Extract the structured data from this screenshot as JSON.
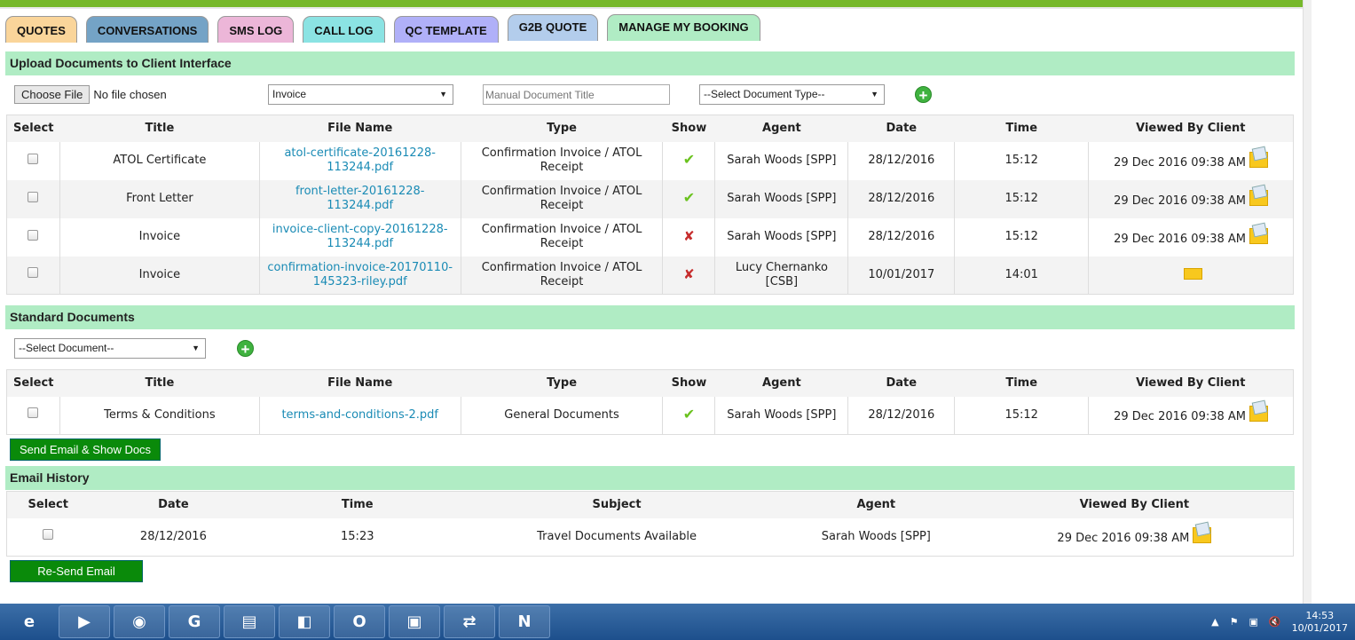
{
  "tabs": [
    {
      "label": "QUOTES",
      "color": "#fad59a"
    },
    {
      "label": "CONVERSATIONS",
      "color": "#74a3c6"
    },
    {
      "label": "SMS LOG",
      "color": "#ecb6d8"
    },
    {
      "label": "CALL LOG",
      "color": "#8be3e3"
    },
    {
      "label": "QC TEMPLATE",
      "color": "#b0b0f8"
    },
    {
      "label": "G2B QUOTE",
      "color": "#b3cdec"
    },
    {
      "label": "MANAGE MY BOOKING",
      "color": "#b0ecc4"
    }
  ],
  "upload": {
    "title": "Upload Documents to Client Interface",
    "choose_file": "Choose File",
    "no_file": "No file chosen",
    "doc_select": "Invoice",
    "title_placeholder": "Manual Document Title",
    "type_select": "--Select Document Type--",
    "headers": [
      "Select",
      "Title",
      "File Name",
      "Type",
      "Show",
      "Agent",
      "Date",
      "Time",
      "Viewed By Client"
    ],
    "rows": [
      {
        "title": "ATOL Certificate",
        "file": "atol-certificate-20161228-113244.pdf",
        "type": "Confirmation Invoice / ATOL Receipt",
        "show": true,
        "agent": "Sarah Woods [SPP]",
        "date": "28/12/2016",
        "time": "15:12",
        "viewed": "29 Dec 2016 09:38 AM"
      },
      {
        "title": "Front Letter",
        "file": "front-letter-20161228-113244.pdf",
        "type": "Confirmation Invoice / ATOL Receipt",
        "show": true,
        "agent": "Sarah Woods [SPP]",
        "date": "28/12/2016",
        "time": "15:12",
        "viewed": "29 Dec 2016 09:38 AM"
      },
      {
        "title": "Invoice",
        "file": "invoice-client-copy-20161228-113244.pdf",
        "type": "Confirmation Invoice / ATOL Receipt",
        "show": false,
        "agent": "Sarah Woods [SPP]",
        "date": "28/12/2016",
        "time": "15:12",
        "viewed": "29 Dec 2016 09:38 AM"
      },
      {
        "title": "Invoice",
        "file": "confirmation-invoice-20170110-145323-riley.pdf",
        "type": "Confirmation Invoice / ATOL Receipt",
        "show": false,
        "agent": "Lucy Chernanko [CSB]",
        "date": "10/01/2017",
        "time": "14:01",
        "viewed": ""
      }
    ]
  },
  "standard": {
    "title": "Standard Documents",
    "doc_select": "--Select Document--",
    "headers": [
      "Select",
      "Title",
      "File Name",
      "Type",
      "Show",
      "Agent",
      "Date",
      "Time",
      "Viewed By Client"
    ],
    "rows": [
      {
        "title": "Terms & Conditions",
        "file": "terms-and-conditions-2.pdf",
        "type": "General Documents",
        "show": true,
        "agent": "Sarah Woods [SPP]",
        "date": "28/12/2016",
        "time": "15:12",
        "viewed": "29 Dec 2016 09:38 AM"
      }
    ],
    "send_button": "Send Email & Show Docs"
  },
  "email_history": {
    "title": "Email History",
    "headers": [
      "Select",
      "Date",
      "Time",
      "Subject",
      "Agent",
      "Viewed By Client"
    ],
    "rows": [
      {
        "date": "28/12/2016",
        "time": "15:23",
        "subject": "Travel Documents Available",
        "agent": "Sarah Woods [SPP]",
        "viewed": "29 Dec 2016 09:38 AM"
      }
    ],
    "resend_button": "Re-Send Email"
  },
  "taskbar": {
    "apps": [
      "internet-explorer",
      "media-player",
      "chrome",
      "g-app",
      "file-explorer",
      "sticky-notes",
      "outlook",
      "remote-desktop",
      "app-arrows",
      "onenote"
    ],
    "time": "14:53",
    "date": "10/01/2017"
  }
}
